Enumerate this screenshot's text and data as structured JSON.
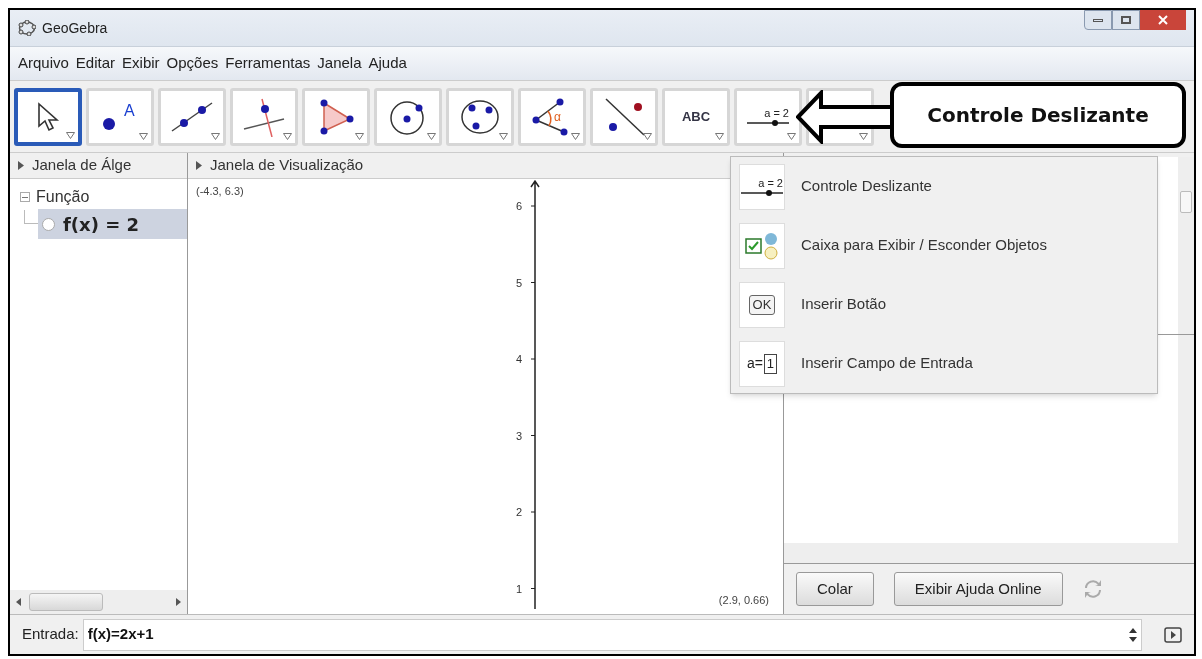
{
  "window": {
    "title": "GeoGebra"
  },
  "menu": [
    "Arquivo",
    "Editar",
    "Exibir",
    "Opções",
    "Ferramentas",
    "Janela",
    "Ajuda"
  ],
  "toolbar": [
    {
      "kind": "move",
      "selected": true
    },
    {
      "kind": "point",
      "label": "A",
      "selected": false
    },
    {
      "kind": "line",
      "selected": false
    },
    {
      "kind": "perpendicular",
      "selected": false
    },
    {
      "kind": "polygon",
      "selected": false
    },
    {
      "kind": "circle",
      "selected": false
    },
    {
      "kind": "conic",
      "selected": false
    },
    {
      "kind": "angle",
      "label": "α",
      "selected": false
    },
    {
      "kind": "reflect",
      "selected": false
    },
    {
      "kind": "text",
      "label": "ABC",
      "selected": false
    },
    {
      "kind": "slider",
      "label": "a = 2",
      "selected": false
    },
    {
      "kind": "blank",
      "selected": false
    }
  ],
  "callout": {
    "text": "Controle Deslizante"
  },
  "algebra": {
    "title": "Janela de Álge",
    "items": [
      {
        "label": "Função",
        "expanded": true,
        "children": [
          {
            "label": "f(x) = 2",
            "selected": true
          }
        ]
      }
    ]
  },
  "graphics": {
    "title": "Janela de Visualização",
    "corner_top": "(-4.3, 6.3)",
    "corner_bottom": "(2.9, 0.66)",
    "y_ticks": [
      "6",
      "5",
      "4",
      "3",
      "2",
      "1"
    ]
  },
  "dropdown": [
    {
      "kind": "slider",
      "icon_text": "a = 2",
      "label": "Controle Deslizante"
    },
    {
      "kind": "checkbox",
      "label": "Caixa para Exibir / Esconder Objetos"
    },
    {
      "kind": "button",
      "icon_text": "OK",
      "label": "Inserir Botão"
    },
    {
      "kind": "input",
      "icon_text": "a=",
      "icon_value": "1",
      "label": "Inserir Campo de Entrada"
    }
  ],
  "help_buttons": [
    "Colar",
    "Exibir Ajuda Online"
  ],
  "input_bar": {
    "label": "Entrada:",
    "value": "f(x)=2x+1"
  }
}
